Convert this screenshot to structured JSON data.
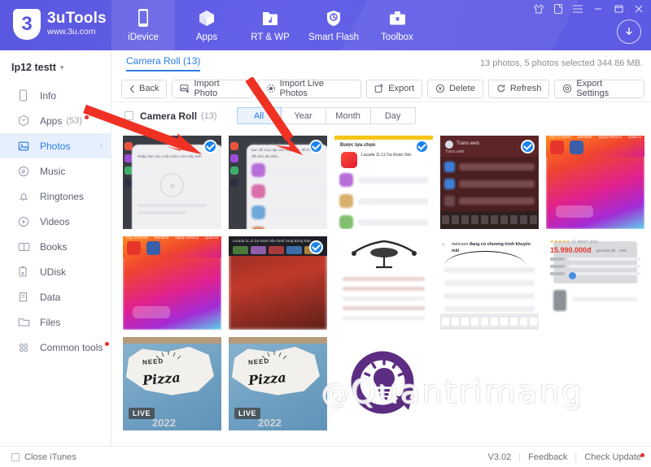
{
  "app": {
    "brand_name": "3uTools",
    "brand_url": "www.3u.com",
    "brand_mark": "3"
  },
  "topnav": {
    "items": [
      {
        "label": "iDevice",
        "icon": "phone-icon",
        "active": true
      },
      {
        "label": "Apps",
        "icon": "cube-icon",
        "active": false
      },
      {
        "label": "RT & WP",
        "icon": "folder-music-icon",
        "active": false
      },
      {
        "label": "Smart Flash",
        "icon": "shield-refresh-icon",
        "active": false
      },
      {
        "label": "Toolbox",
        "icon": "toolbox-icon",
        "active": false
      }
    ],
    "window_controls": [
      "tshirt-icon",
      "note-icon",
      "menu-icon",
      "minimize-icon",
      "maximize-icon",
      "close-icon"
    ],
    "download_button": "download-icon"
  },
  "sidebar": {
    "device_name": "Ip12 testt",
    "items": [
      {
        "label": "Info",
        "icon": "phone-outline-icon",
        "count": "",
        "dot": false,
        "active": false
      },
      {
        "label": "Apps",
        "icon": "cube-outline-icon",
        "count": "(53)",
        "dot": true,
        "active": false
      },
      {
        "label": "Photos",
        "icon": "image-icon",
        "count": "",
        "dot": false,
        "active": true
      },
      {
        "label": "Music",
        "icon": "disc-icon",
        "count": "",
        "dot": false,
        "active": false
      },
      {
        "label": "Ringtones",
        "icon": "bell-icon",
        "count": "",
        "dot": false,
        "active": false
      },
      {
        "label": "Videos",
        "icon": "play-circle-icon",
        "count": "",
        "dot": false,
        "active": false
      },
      {
        "label": "Books",
        "icon": "book-icon",
        "count": "",
        "dot": false,
        "active": false
      },
      {
        "label": "UDisk",
        "icon": "usb-disk-icon",
        "count": "",
        "dot": false,
        "active": false
      },
      {
        "label": "Data",
        "icon": "clipboard-icon",
        "count": "",
        "dot": false,
        "active": false
      },
      {
        "label": "Files",
        "icon": "folder-icon",
        "count": "",
        "dot": false,
        "active": false
      },
      {
        "label": "Common tools",
        "icon": "grid-dots-icon",
        "count": "",
        "dot": true,
        "active": false
      }
    ]
  },
  "content": {
    "breadcrumb": "Camera Roll (13)",
    "status": "13 photos, 5 photos selected 344.86 MB.",
    "toolbar": [
      {
        "label": "Back",
        "icon": "chevron-left-icon"
      },
      {
        "label": "Import Photo",
        "icon": "import-photo-icon"
      },
      {
        "label": "Import Live Photos",
        "icon": "live-photo-icon"
      },
      {
        "label": "Export",
        "icon": "export-icon"
      },
      {
        "label": "Delete",
        "icon": "delete-icon"
      },
      {
        "label": "Refresh",
        "icon": "refresh-icon"
      },
      {
        "label": "Export Settings",
        "icon": "settings-gear-icon"
      }
    ],
    "album": {
      "label": "Camera Roll",
      "count": "(13)"
    },
    "segments": [
      {
        "label": "All",
        "active": true
      },
      {
        "label": "Year",
        "active": false
      },
      {
        "label": "Month",
        "active": false
      },
      {
        "label": "Day",
        "active": false
      }
    ],
    "photos": [
      {
        "kind": "sheet",
        "selected": true,
        "live": false,
        "year": ""
      },
      {
        "kind": "store-sheet",
        "selected": true,
        "live": false,
        "year": ""
      },
      {
        "kind": "store",
        "selected": true,
        "live": false,
        "year": ""
      },
      {
        "kind": "dark",
        "selected": true,
        "live": false,
        "year": "",
        "caption": "Trans web"
      },
      {
        "kind": "ios",
        "selected": false,
        "live": false,
        "year": ""
      },
      {
        "kind": "ios",
        "selected": false,
        "live": false,
        "year": ""
      },
      {
        "kind": "blurphoto",
        "selected": true,
        "live": false,
        "year": ""
      },
      {
        "kind": "chair",
        "selected": false,
        "live": false,
        "year": ""
      },
      {
        "kind": "search",
        "selected": false,
        "live": false,
        "year": "",
        "caption": "đang có chương trình khuyến mãi"
      },
      {
        "kind": "price",
        "selected": false,
        "live": false,
        "year": "",
        "price": "15.990.000đ"
      },
      {
        "kind": "pizza",
        "selected": false,
        "live": true,
        "year": "2022",
        "live_label": "LIVE",
        "brand": "NEED",
        "word": "Pizza"
      },
      {
        "kind": "pizza",
        "selected": false,
        "live": true,
        "year": "2022",
        "live_label": "LIVE",
        "brand": "NEED",
        "word": "Pizza"
      },
      {
        "kind": "logo",
        "selected": false,
        "live": false,
        "year": ""
      }
    ],
    "watermark": "Quantrimang"
  },
  "footer": {
    "close_itunes": "Close iTunes",
    "version": "V3.02",
    "feedback": "Feedback",
    "check_update": "Check Update"
  },
  "colors": {
    "brand_purple": "#5d5ae3",
    "accent_blue": "#2c7be5",
    "check_blue": "#1a84ee",
    "alert_red": "#e8352b",
    "arrow_red": "#ef3124"
  }
}
